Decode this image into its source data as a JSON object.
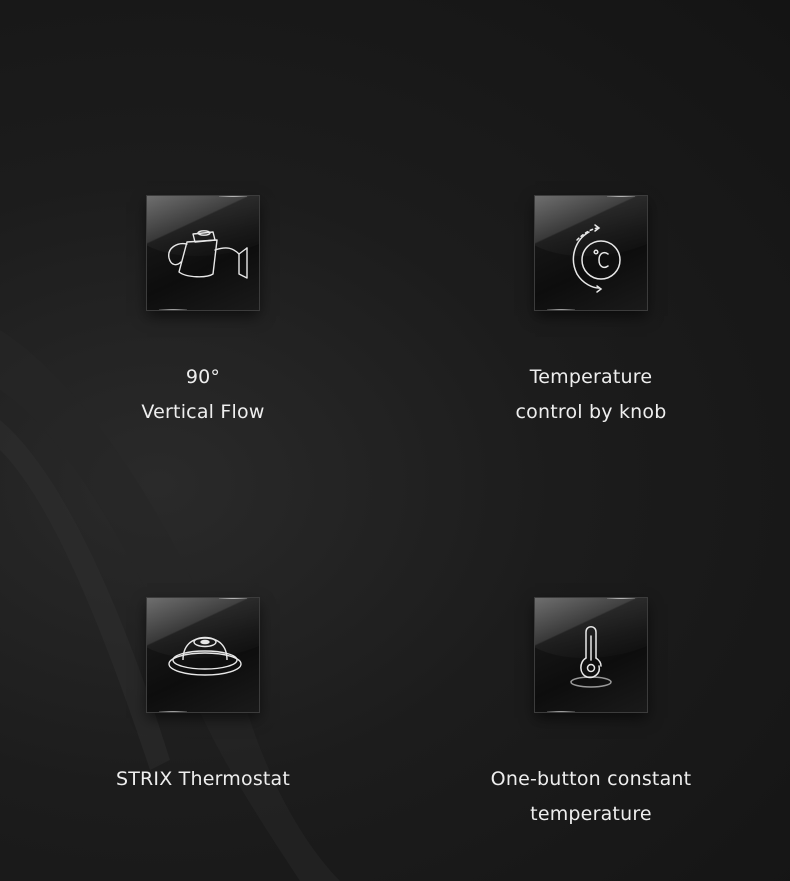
{
  "features": [
    {
      "icon": "gooseneck-kettle-icon",
      "line1": "90°",
      "line2": "Vertical Flow"
    },
    {
      "icon": "temperature-knob-icon",
      "line1": "Temperature",
      "line2": "control by knob"
    },
    {
      "icon": "thermostat-icon",
      "line1": "STRIX Thermostat",
      "line2": ""
    },
    {
      "icon": "thermometer-button-icon",
      "line1": "One-button constant",
      "line2": "temperature"
    }
  ]
}
